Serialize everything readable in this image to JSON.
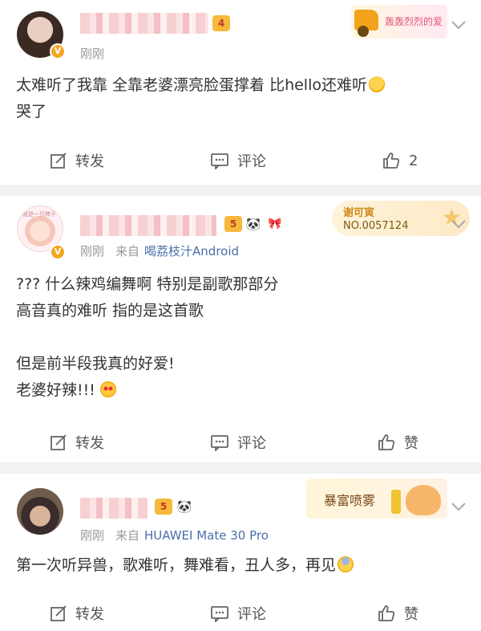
{
  "posts": [
    {
      "time": "刚刚",
      "text": "太难听了我靠 全靠老婆漂亮脸蛋撑着 比hello还难听",
      "text2": "哭了",
      "actions": {
        "repost": "转发",
        "comment": "评论",
        "like": "2"
      },
      "deco_text": "轰轰烈烈的爱",
      "verified_mark": "V",
      "crown_level": "4"
    },
    {
      "time": "刚刚",
      "source_label": "来自",
      "source_name": "喝荔枝汁Android",
      "lines": [
        "??? 什么辣鸡编舞啊 特别是副歌那部分",
        "高音真的难听 指的是这首歌",
        "",
        "但是前半段我真的好爱!",
        "老婆好辣!!! "
      ],
      "actions": {
        "repost": "转发",
        "comment": "评论",
        "like": "赞"
      },
      "fan_badge": {
        "name": "谢可寅",
        "number": "NO.0057124"
      },
      "avatar_caption": "我是一只柿子",
      "verified_mark": "V",
      "crown_level": "5"
    },
    {
      "time": "刚刚",
      "source_label": "来自",
      "source_name": "HUAWEI Mate 30 Pro",
      "text": "第一次听异兽，歌难听，舞难看，丑人多，再见",
      "actions": {
        "repost": "转发",
        "comment": "评论",
        "like": "赞"
      },
      "deco_text": "暴富喷雾",
      "crown_level": "5"
    }
  ],
  "colors": {
    "link": "#4a6ea8",
    "meta": "#999999",
    "separator": "#f2f2f2",
    "vip": "#f5a623"
  }
}
